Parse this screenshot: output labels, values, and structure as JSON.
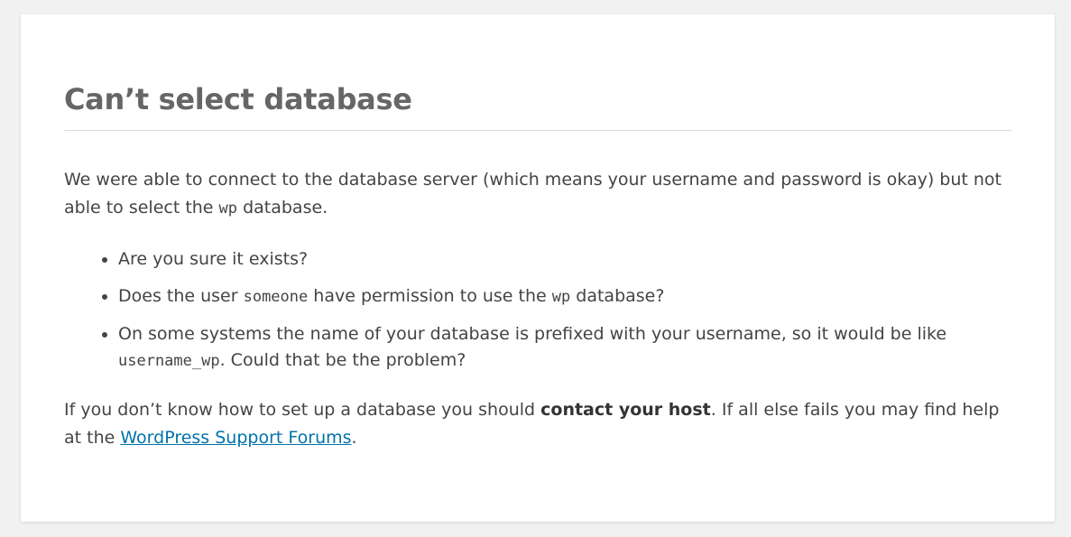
{
  "error": {
    "title": "Can’t select database",
    "intro_text": "We were able to connect to the database server (which means your username and password is okay) but not able to select the ",
    "intro_db_code": "wp",
    "intro_suffix": " database.",
    "bullets": [
      {
        "text": "Are you sure it exists?"
      },
      {
        "prefix": "Does the user ",
        "user_code": "someone",
        "middle": " have permission to use the ",
        "db_code": "wp",
        "suffix": " database?"
      },
      {
        "prefix": "On some systems the name of your database is prefixed with your username, so it would be like ",
        "code": "username_wp",
        "suffix": ". Could that be the problem?"
      }
    ],
    "help_prefix": "If you don’t know how to set up a database you should ",
    "help_bold": "contact your host",
    "help_middle": ". If all else fails you may find help at the ",
    "help_link": "WordPress Support Forums",
    "help_suffix": "."
  },
  "colors": {
    "link": "#0073aa",
    "title": "#666666",
    "text": "#444444",
    "background": "#f1f1f1",
    "card": "#ffffff"
  }
}
